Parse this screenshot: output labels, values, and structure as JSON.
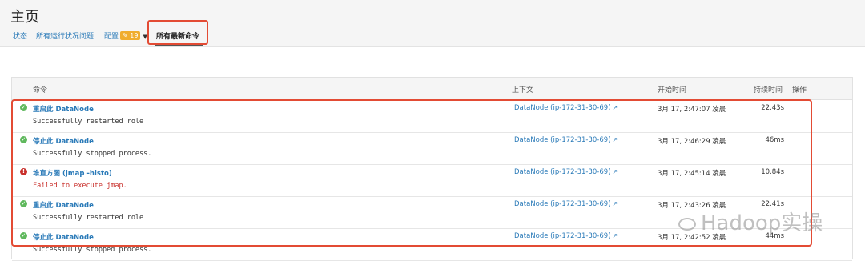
{
  "page": {
    "title": "主页"
  },
  "nav": {
    "status": "状态",
    "health_issues": "所有运行状况问题",
    "config": "配置",
    "config_badge": "19",
    "recent_commands": "所有最新命令"
  },
  "table": {
    "headers": {
      "command": "命令",
      "context": "上下文",
      "start_time": "开始时间",
      "duration": "持续时间",
      "actions": "操作"
    },
    "rows": [
      {
        "status": "success",
        "command": "重启此 DataNode",
        "message": "Successfully restarted role",
        "context": "DataNode (ip-172-31-30-69)",
        "start_time": "3月 17, 2:47:07 凌晨",
        "duration": "22.43s"
      },
      {
        "status": "success",
        "command": "停止此 DataNode",
        "message": "Successfully stopped process.",
        "context": "DataNode (ip-172-31-30-69)",
        "start_time": "3月 17, 2:46:29 凌晨",
        "duration": "46ms"
      },
      {
        "status": "error",
        "command": "堆直方图 (jmap -histo)",
        "message": "Failed to execute jmap.",
        "context": "DataNode (ip-172-31-30-69)",
        "start_time": "3月 17, 2:45:14 凌晨",
        "duration": "10.84s"
      },
      {
        "status": "success",
        "command": "重启此 DataNode",
        "message": "Successfully restarted role",
        "context": "DataNode (ip-172-31-30-69)",
        "start_time": "3月 17, 2:43:26 凌晨",
        "duration": "22.41s"
      },
      {
        "status": "success",
        "command": "停止此 DataNode",
        "message": "Successfully stopped process.",
        "context": "DataNode (ip-172-31-30-69)",
        "start_time": "3月 17, 2:42:52 凌晨",
        "duration": "44ms"
      }
    ]
  },
  "watermark": "Hadoop实操",
  "colors": {
    "accent": "#e34b34",
    "link": "#2a7ab8",
    "ok": "#5fb85d",
    "error": "#c9302c",
    "badge": "#f0ad2e"
  }
}
